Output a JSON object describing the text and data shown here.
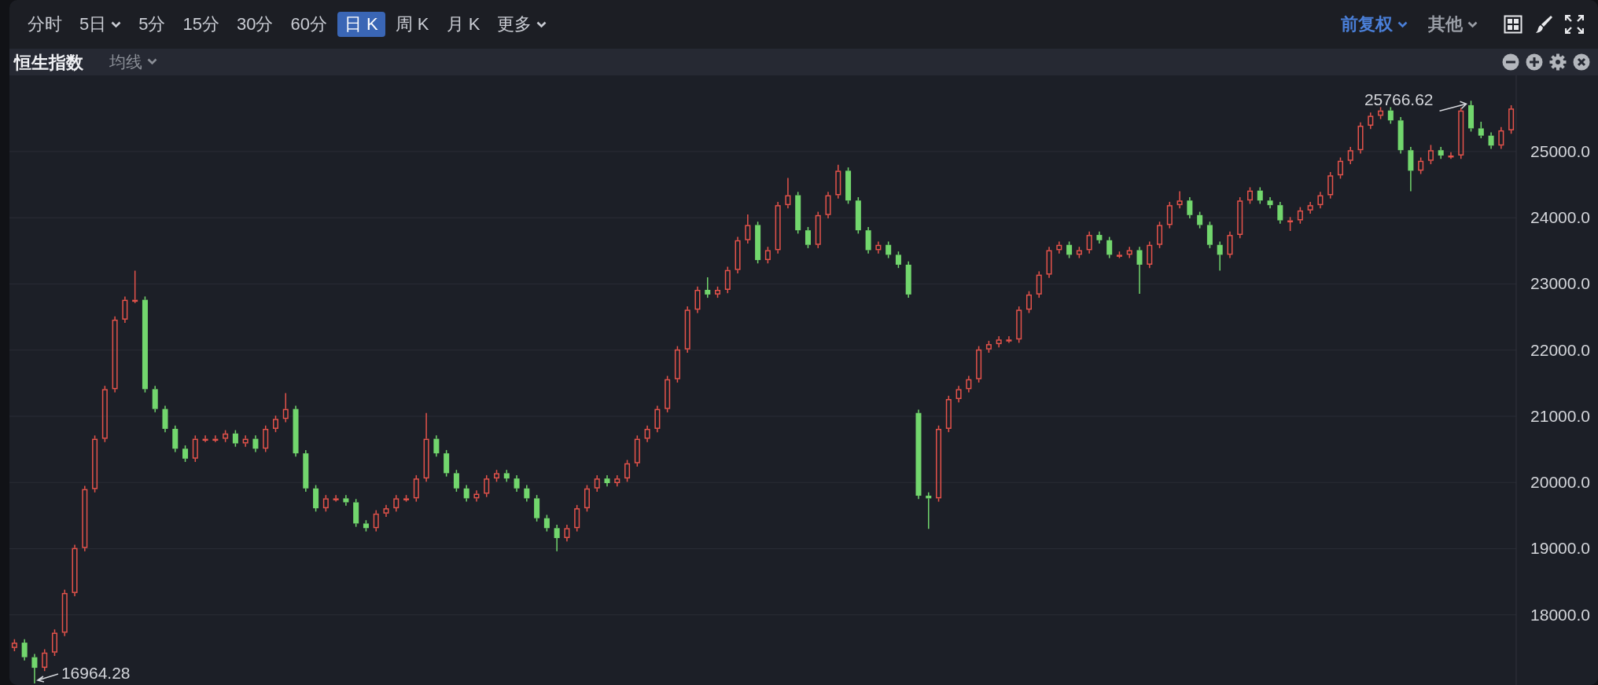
{
  "toolbar": {
    "periods": [
      {
        "label": "分时",
        "selected": false,
        "kind": "plain"
      },
      {
        "label": "5日",
        "selected": false,
        "kind": "dropdown"
      },
      {
        "label": "5分",
        "selected": false,
        "kind": "plain"
      },
      {
        "label": "15分",
        "selected": false,
        "kind": "plain"
      },
      {
        "label": "30分",
        "selected": false,
        "kind": "plain"
      },
      {
        "label": "60分",
        "selected": false,
        "kind": "plain"
      },
      {
        "label": "日 K",
        "selected": true,
        "kind": "plain"
      },
      {
        "label": "周 K",
        "selected": false,
        "kind": "plain"
      },
      {
        "label": "月 K",
        "selected": false,
        "kind": "plain"
      },
      {
        "label": "更多",
        "selected": false,
        "kind": "dropdown"
      }
    ],
    "right_menus": [
      {
        "label": "前复权",
        "selected": true
      },
      {
        "label": "其他",
        "selected": false
      }
    ]
  },
  "chart_header": {
    "title": "恒生指数",
    "indicator_menu": "均线"
  },
  "chart": {
    "chart_data": {
      "type": "candlestick",
      "grid": true,
      "ylim": [
        16940,
        26150
      ],
      "yticks": [
        {
          "value": 18000,
          "label": "18000.0"
        },
        {
          "value": 19000,
          "label": "19000.0"
        },
        {
          "value": 20000,
          "label": "20000.0"
        },
        {
          "value": 21000,
          "label": "21000.0"
        },
        {
          "value": 22000,
          "label": "22000.0"
        },
        {
          "value": 23000,
          "label": "23000.0"
        },
        {
          "value": 24000,
          "label": "24000.0"
        },
        {
          "value": 25000,
          "label": "25000.0"
        }
      ],
      "ohlc": [
        [
          17500,
          17630,
          17450,
          17580
        ],
        [
          17580,
          17630,
          17310,
          17360
        ],
        [
          17360,
          17410,
          16964.28,
          17200
        ],
        [
          17200,
          17480,
          17150,
          17430
        ],
        [
          17430,
          17780,
          17380,
          17730
        ],
        [
          17730,
          18380,
          17680,
          18330
        ],
        [
          18330,
          19060,
          18280,
          19010
        ],
        [
          19010,
          19950,
          18960,
          19900
        ],
        [
          19900,
          20710,
          19850,
          20660
        ],
        [
          20660,
          21460,
          20610,
          21410
        ],
        [
          21410,
          22510,
          21360,
          22460
        ],
        [
          22460,
          22810,
          22410,
          22760
        ],
        [
          22760,
          23200,
          22710,
          22760
        ],
        [
          22760,
          22810,
          21360,
          21410
        ],
        [
          21410,
          21460,
          21060,
          21110
        ],
        [
          21110,
          21160,
          20760,
          20810
        ],
        [
          20810,
          20860,
          20460,
          20510
        ],
        [
          20510,
          20560,
          20310,
          20360
        ],
        [
          20360,
          20710,
          20310,
          20660
        ],
        [
          20660,
          20710,
          20610,
          20660
        ],
        [
          20660,
          20710,
          20610,
          20660
        ],
        [
          20660,
          20790,
          20610,
          20740
        ],
        [
          20740,
          20790,
          20540,
          20590
        ],
        [
          20590,
          20710,
          20540,
          20660
        ],
        [
          20660,
          20710,
          20460,
          20510
        ],
        [
          20510,
          20860,
          20460,
          20810
        ],
        [
          20810,
          21010,
          20760,
          20960
        ],
        [
          20960,
          21350,
          20910,
          21110
        ],
        [
          21110,
          21160,
          20390,
          20440
        ],
        [
          20440,
          20490,
          19860,
          19910
        ],
        [
          19910,
          19960,
          19560,
          19610
        ],
        [
          19610,
          19810,
          19560,
          19760
        ],
        [
          19760,
          19810,
          19710,
          19760
        ],
        [
          19760,
          19810,
          19650,
          19700
        ],
        [
          19700,
          19750,
          19330,
          19380
        ],
        [
          19380,
          19430,
          19260,
          19310
        ],
        [
          19310,
          19580,
          19260,
          19530
        ],
        [
          19530,
          19660,
          19480,
          19610
        ],
        [
          19610,
          19810,
          19560,
          19760
        ],
        [
          19760,
          19810,
          19710,
          19760
        ],
        [
          19760,
          20110,
          19710,
          20060
        ],
        [
          20060,
          21050,
          20010,
          20660
        ],
        [
          20660,
          20710,
          20390,
          20440
        ],
        [
          20440,
          20490,
          20090,
          20140
        ],
        [
          20140,
          20190,
          19860,
          19910
        ],
        [
          19910,
          19960,
          19710,
          19760
        ],
        [
          19760,
          19880,
          19710,
          19830
        ],
        [
          19830,
          20110,
          19780,
          20060
        ],
        [
          20060,
          20190,
          20010,
          20140
        ],
        [
          20140,
          20190,
          20010,
          20060
        ],
        [
          20060,
          20110,
          19860,
          19910
        ],
        [
          19910,
          19960,
          19710,
          19760
        ],
        [
          19760,
          19810,
          19410,
          19460
        ],
        [
          19460,
          19510,
          19260,
          19310
        ],
        [
          19310,
          19360,
          18960,
          19160
        ],
        [
          19160,
          19360,
          19110,
          19310
        ],
        [
          19310,
          19660,
          19260,
          19610
        ],
        [
          19610,
          19960,
          19560,
          19910
        ],
        [
          19910,
          20110,
          19860,
          20060
        ],
        [
          20060,
          20110,
          19940,
          19990
        ],
        [
          19990,
          20110,
          19940,
          20060
        ],
        [
          20060,
          20340,
          20010,
          20290
        ],
        [
          20290,
          20710,
          20240,
          20660
        ],
        [
          20660,
          20860,
          20610,
          20810
        ],
        [
          20810,
          21160,
          20760,
          21110
        ],
        [
          21110,
          21610,
          21060,
          21560
        ],
        [
          21560,
          22060,
          21510,
          22010
        ],
        [
          22010,
          22660,
          21960,
          22610
        ],
        [
          22610,
          22960,
          22560,
          22910
        ],
        [
          22910,
          23100,
          22790,
          22840
        ],
        [
          22840,
          22960,
          22790,
          22910
        ],
        [
          22910,
          23260,
          22860,
          23210
        ],
        [
          23210,
          23710,
          23160,
          23660
        ],
        [
          23660,
          24050,
          23610,
          23890
        ],
        [
          23890,
          23940,
          23310,
          23360
        ],
        [
          23360,
          23560,
          23310,
          23510
        ],
        [
          23510,
          24240,
          23460,
          24190
        ],
        [
          24190,
          24600,
          24140,
          24340
        ],
        [
          24340,
          24390,
          23760,
          23810
        ],
        [
          23810,
          23860,
          23540,
          23590
        ],
        [
          23590,
          24090,
          23540,
          24040
        ],
        [
          24040,
          24390,
          23990,
          24340
        ],
        [
          24340,
          24800,
          24290,
          24710
        ],
        [
          24710,
          24760,
          24210,
          24260
        ],
        [
          24260,
          24310,
          23760,
          23810
        ],
        [
          23810,
          23860,
          23460,
          23510
        ],
        [
          23510,
          23640,
          23460,
          23590
        ],
        [
          23590,
          23640,
          23390,
          23440
        ],
        [
          23440,
          23490,
          23240,
          23290
        ],
        [
          23290,
          23340,
          22790,
          22840
        ],
        [
          21050,
          21100,
          19750,
          19800
        ],
        [
          19800,
          19850,
          19300,
          19760
        ],
        [
          19760,
          20860,
          19710,
          20810
        ],
        [
          20810,
          21310,
          20760,
          21260
        ],
        [
          21260,
          21460,
          21210,
          21410
        ],
        [
          21410,
          21610,
          21360,
          21560
        ],
        [
          21560,
          22060,
          21510,
          22010
        ],
        [
          22010,
          22140,
          21960,
          22090
        ],
        [
          22090,
          22210,
          22040,
          22160
        ],
        [
          22160,
          22210,
          22110,
          22160
        ],
        [
          22160,
          22660,
          22110,
          22610
        ],
        [
          22610,
          22890,
          22560,
          22840
        ],
        [
          22840,
          23190,
          22790,
          23140
        ],
        [
          23140,
          23560,
          23090,
          23510
        ],
        [
          23510,
          23640,
          23460,
          23590
        ],
        [
          23590,
          23640,
          23390,
          23440
        ],
        [
          23440,
          23560,
          23390,
          23510
        ],
        [
          23510,
          23790,
          23460,
          23740
        ],
        [
          23740,
          23790,
          23610,
          23660
        ],
        [
          23660,
          23710,
          23390,
          23440
        ],
        [
          23440,
          23490,
          23390,
          23440
        ],
        [
          23440,
          23560,
          23390,
          23510
        ],
        [
          23510,
          23560,
          22850,
          23290
        ],
        [
          23290,
          23640,
          23240,
          23590
        ],
        [
          23590,
          23940,
          23540,
          23890
        ],
        [
          23890,
          24240,
          23840,
          24190
        ],
        [
          24190,
          24400,
          24140,
          24260
        ],
        [
          24260,
          24310,
          23990,
          24040
        ],
        [
          24040,
          24090,
          23840,
          23890
        ],
        [
          23890,
          23940,
          23540,
          23590
        ],
        [
          23590,
          23640,
          23200,
          23440
        ],
        [
          23440,
          23790,
          23390,
          23740
        ],
        [
          23740,
          24310,
          23690,
          24260
        ],
        [
          24260,
          24460,
          24210,
          24410
        ],
        [
          24410,
          24460,
          24210,
          24260
        ],
        [
          24260,
          24310,
          24140,
          24190
        ],
        [
          24190,
          24240,
          23910,
          23960
        ],
        [
          23960,
          24010,
          23800,
          23960
        ],
        [
          23960,
          24160,
          23910,
          24110
        ],
        [
          24110,
          24240,
          24060,
          24190
        ],
        [
          24190,
          24390,
          24140,
          24340
        ],
        [
          24340,
          24690,
          24290,
          24640
        ],
        [
          24640,
          24910,
          24590,
          24860
        ],
        [
          24860,
          25070,
          24810,
          25020
        ],
        [
          25020,
          25440,
          24970,
          25390
        ],
        [
          25390,
          25590,
          25340,
          25540
        ],
        [
          25540,
          25670,
          25490,
          25620
        ],
        [
          25620,
          25670,
          25420,
          25470
        ],
        [
          25470,
          25520,
          24970,
          25020
        ],
        [
          25020,
          25070,
          24400,
          24710
        ],
        [
          24710,
          24910,
          24660,
          24860
        ],
        [
          24860,
          25100,
          24810,
          25020
        ],
        [
          25020,
          25070,
          24890,
          24940
        ],
        [
          24940,
          24990,
          24890,
          24940
        ],
        [
          24940,
          25660,
          24890,
          25620
        ],
        [
          25700,
          25766.62,
          25300,
          25350
        ],
        [
          25350,
          25450,
          25200,
          25240
        ],
        [
          25240,
          25290,
          25040,
          25090
        ],
        [
          25090,
          25370,
          25040,
          25320
        ],
        [
          25320,
          25700,
          25270,
          25650
        ]
      ],
      "annotations": [
        "25766.62",
        "16964.28"
      ]
    }
  }
}
